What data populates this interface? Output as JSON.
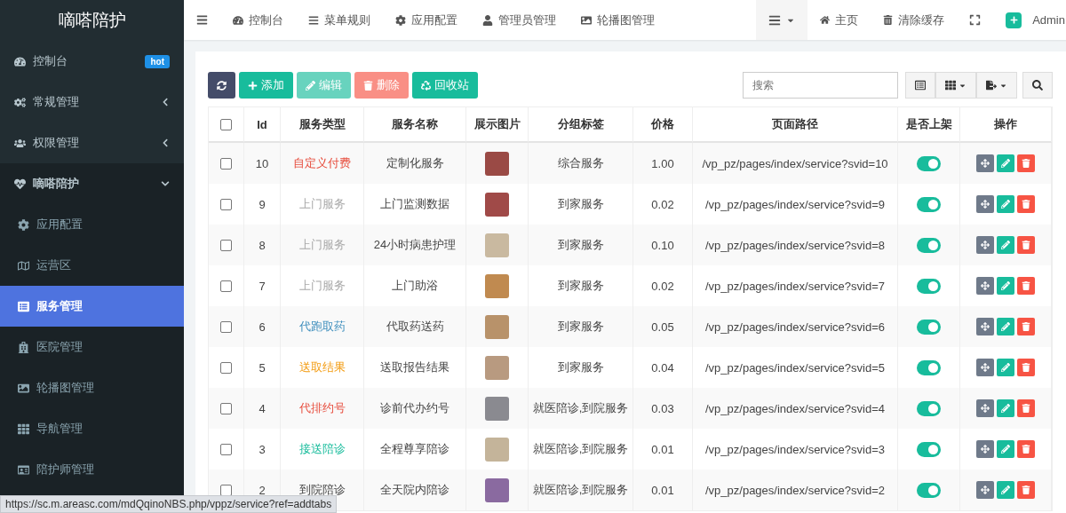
{
  "sidebar": {
    "logo": "嘀嗒陪护",
    "items": [
      {
        "label": "控制台",
        "badge": "hot",
        "selected": false
      },
      {
        "label": "常规管理",
        "expanded": false,
        "selected": false
      },
      {
        "label": "权限管理",
        "expanded": false,
        "selected": false
      },
      {
        "label": "嘀嗒陪护",
        "expanded": true,
        "selected": false,
        "children": [
          {
            "label": "应用配置",
            "selected": false
          },
          {
            "label": "运营区",
            "selected": false
          },
          {
            "label": "服务管理",
            "selected": true
          },
          {
            "label": "医院管理",
            "selected": false
          },
          {
            "label": "轮播图管理",
            "selected": false
          },
          {
            "label": "导航管理",
            "selected": false
          },
          {
            "label": "陪护师管理",
            "selected": false
          }
        ]
      }
    ]
  },
  "top_nav": {
    "tabs": [
      {
        "label": "控制台"
      },
      {
        "label": "菜单规则"
      },
      {
        "label": "应用配置"
      },
      {
        "label": "管理员管理"
      },
      {
        "label": "轮播图管理"
      }
    ],
    "links": [
      {
        "label": "主页"
      },
      {
        "label": "清除缓存"
      }
    ],
    "user": "Admin"
  },
  "toolbar": {
    "buttons": [
      {
        "label": "添加",
        "kind": "add",
        "disabled": false
      },
      {
        "label": "编辑",
        "kind": "edit",
        "disabled": true
      },
      {
        "label": "删除",
        "kind": "delete",
        "disabled": true
      },
      {
        "label": "回收站",
        "kind": "recycle",
        "disabled": false
      }
    ],
    "search": {
      "placeholder": "搜索"
    }
  },
  "table": {
    "select_all_checked": false,
    "columns": [
      "Id",
      "服务类型",
      "服务名称",
      "展示图片",
      "分组标签",
      "价格",
      "页面路径",
      "是否上架",
      "操作"
    ],
    "rows": [
      {
        "checked": false,
        "id": "10",
        "type": "自定义付费",
        "color": "#e74c3c",
        "name": "定制化服务",
        "tag": "综合服务",
        "price": "1.00",
        "path": "/vp_pz/pages/index/service?svid=10",
        "on": true
      },
      {
        "checked": false,
        "id": "9",
        "type": "上门服务",
        "color": "#a8a8a8",
        "name": "上门监测数据",
        "tag": "到家服务",
        "price": "0.02",
        "path": "/vp_pz/pages/index/service?svid=9",
        "on": true
      },
      {
        "checked": false,
        "id": "8",
        "type": "上门服务",
        "color": "#a8a8a8",
        "name": "24小时病患护理",
        "tag": "到家服务",
        "price": "0.10",
        "path": "/vp_pz/pages/index/service?svid=8",
        "on": true
      },
      {
        "checked": false,
        "id": "7",
        "type": "上门服务",
        "color": "#a8a8a8",
        "name": "上门助浴",
        "tag": "到家服务",
        "price": "0.02",
        "path": "/vp_pz/pages/index/service?svid=7",
        "on": true
      },
      {
        "checked": false,
        "id": "6",
        "type": "代跑取药",
        "color": "#3c8dbc",
        "name": "代取药送药",
        "tag": "到家服务",
        "price": "0.05",
        "path": "/vp_pz/pages/index/service?svid=6",
        "on": true
      },
      {
        "checked": false,
        "id": "5",
        "type": "送取结果",
        "color": "#f39c12",
        "name": "送取报告结果",
        "tag": "到家服务",
        "price": "0.04",
        "path": "/vp_pz/pages/index/service?svid=5",
        "on": true
      },
      {
        "checked": false,
        "id": "4",
        "type": "代排约号",
        "color": "#e74c3c",
        "name": "诊前代办约号",
        "tag": "就医陪诊,到院服务",
        "price": "0.03",
        "path": "/vp_pz/pages/index/service?svid=4",
        "on": true
      },
      {
        "checked": false,
        "id": "3",
        "type": "接送陪诊",
        "color": "#18bc9c",
        "name": "全程尊享陪诊",
        "tag": "就医陪诊,到院服务",
        "price": "0.01",
        "path": "/vp_pz/pages/index/service?svid=3",
        "on": true
      },
      {
        "checked": false,
        "id": "2",
        "type": "到院陪诊",
        "color": "#444444",
        "name": "全天院内陪诊",
        "tag": "就医陪诊,到院服务",
        "price": "0.01",
        "path": "/vp_pz/pages/index/service?svid=2",
        "on": true
      }
    ]
  },
  "status_bar": "https://sc.m.areasc.com/mdQqinoNBS.php/vppz/service?ref=addtabs"
}
